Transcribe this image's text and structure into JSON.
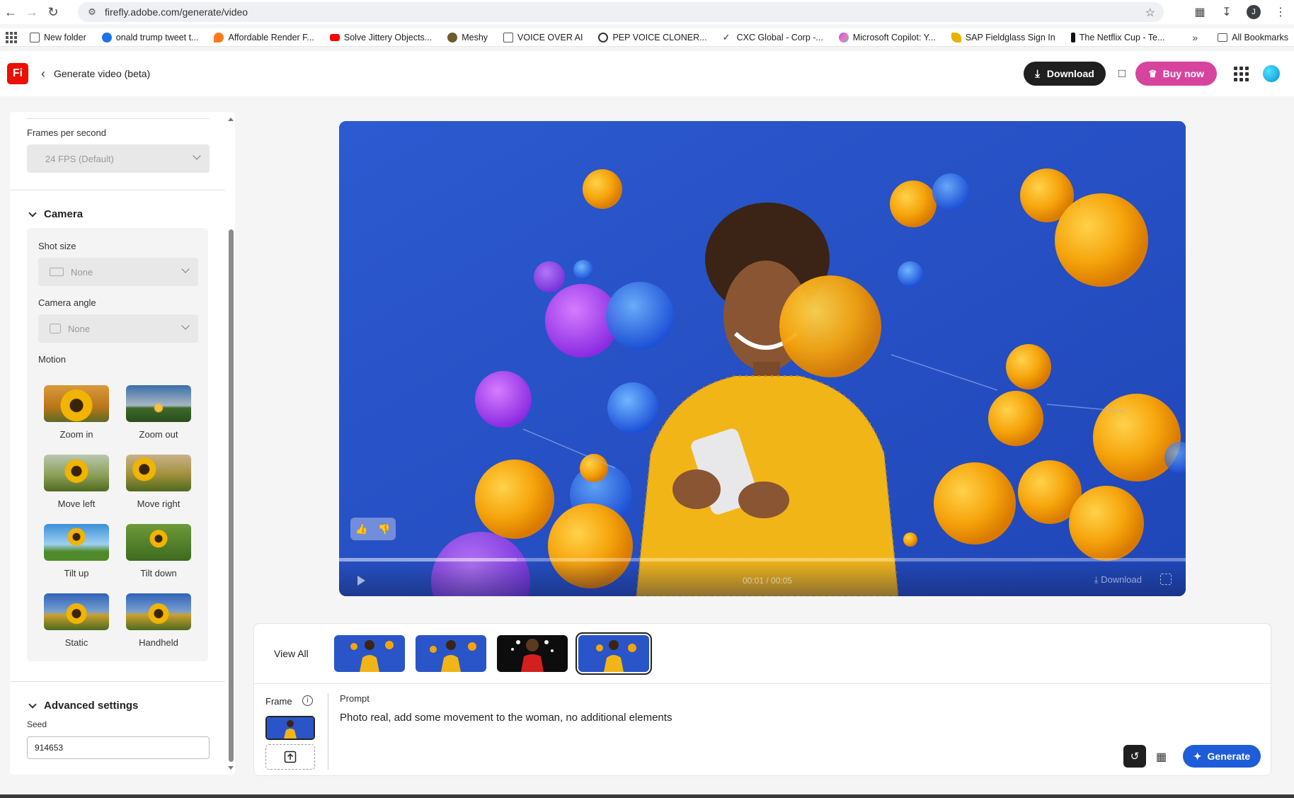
{
  "browser": {
    "url": "firefly.adobe.com/generate/video",
    "profile_initial": "J",
    "bookmarks": [
      {
        "label": "New folder",
        "icon": "folder-icon",
        "color": "#555555"
      },
      {
        "label": "onald trump tweet t...",
        "icon": "globe-icon",
        "color": "#1a73e8"
      },
      {
        "label": "Affordable Render F...",
        "icon": "flame-icon",
        "color": "#ff7a1a"
      },
      {
        "label": "Solve Jittery Objects...",
        "icon": "youtube-icon",
        "color": "#ff0000"
      },
      {
        "label": "Meshy",
        "icon": "meshy-icon",
        "color": "#6b5b2e"
      },
      {
        "label": "VOICE OVER AI",
        "icon": "folder-icon",
        "color": "#555555"
      },
      {
        "label": "PEP VOICE CLONER...",
        "icon": "gear-icon",
        "color": "#333333"
      },
      {
        "label": "CXC Global - Corp -...",
        "icon": "check-icon",
        "color": "#333333"
      },
      {
        "label": "Microsoft Copilot: Y...",
        "icon": "copilot-icon",
        "color": "#7b61ff"
      },
      {
        "label": "SAP Fieldglass Sign In",
        "icon": "fieldglass-icon",
        "color": "#e7b300"
      },
      {
        "label": "The Netflix Cup - Te...",
        "icon": "netflix-icon",
        "color": "#111111"
      }
    ],
    "all_bookmarks": "All Bookmarks"
  },
  "header": {
    "logo": "Fi",
    "title": "Generate video (beta)",
    "download_label": "Download",
    "buy_label": "Buy now",
    "colors": {
      "download_bg": "#1f1f1f",
      "buy_bg": "#d6449e",
      "logo_bg": "#eb1000"
    }
  },
  "left_panel": {
    "fps": {
      "label": "Frames per second",
      "value": "24 FPS (Default)"
    },
    "camera": {
      "title": "Camera",
      "shot_size": {
        "label": "Shot size",
        "value": "None"
      },
      "camera_angle": {
        "label": "Camera angle",
        "value": "None"
      },
      "motion_label": "Motion",
      "motions": [
        {
          "label": "Zoom in",
          "sky": "sunflower"
        },
        {
          "label": "Zoom out",
          "sky": "dusk"
        },
        {
          "label": "Move left",
          "sky": "field"
        },
        {
          "label": "Move right",
          "sky": "field"
        },
        {
          "label": "Tilt up",
          "sky": "blue"
        },
        {
          "label": "Tilt down",
          "sky": "green"
        },
        {
          "label": "Static",
          "sky": "blue"
        },
        {
          "label": "Handheld",
          "sky": "blue"
        }
      ]
    },
    "advanced": {
      "title": "Advanced settings",
      "seed_label": "Seed",
      "seed_value": "914653"
    }
  },
  "video": {
    "timecode": "00:01 / 00:05",
    "download_label": "Download",
    "progress": 0.21
  },
  "bottom": {
    "view_all": "View All",
    "thumbnails": [
      {
        "bg": "#2a55c8",
        "selected": false
      },
      {
        "bg": "#2a55c8",
        "selected": false
      },
      {
        "bg": "#0d0d0d",
        "selected": false
      },
      {
        "bg": "#2a55c8",
        "selected": true
      }
    ],
    "frame_label": "Frame",
    "prompt_label": "Prompt",
    "prompt_text": "Photo real, add some movement to the woman, no additional elements",
    "generate_label": "Generate",
    "generate_color": "#1f5cd9"
  }
}
